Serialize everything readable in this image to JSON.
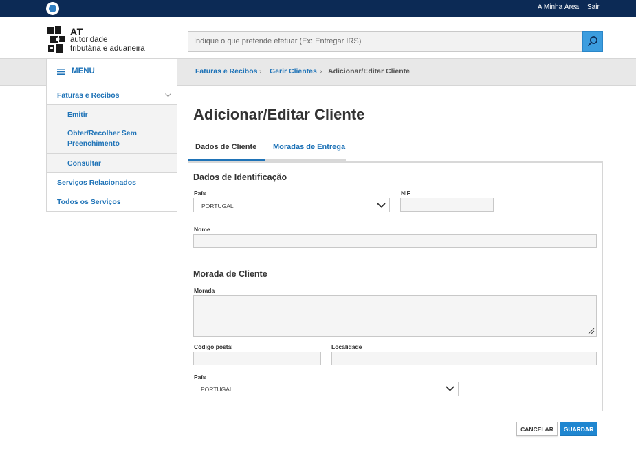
{
  "topbar": {
    "my_area": "A Minha Área",
    "logout": "Sair"
  },
  "brand": {
    "acronym": "AT",
    "line1": "autoridade",
    "line2": "tributária e aduaneira"
  },
  "search": {
    "placeholder": "Indique o que pretende efetuar (Ex: Entregar IRS)"
  },
  "menu": {
    "label": "MENU"
  },
  "breadcrumb": [
    {
      "label": "Faturas e Recibos"
    },
    {
      "label": "Gerir Clientes"
    },
    {
      "label": "Adicionar/Editar Cliente"
    }
  ],
  "sidebar": {
    "items": [
      {
        "label": "Faturas e Recibos"
      },
      {
        "label": "Emitir"
      },
      {
        "label": "Obter/Recolher Sem",
        "label2": "Preenchimento"
      },
      {
        "label": "Consultar"
      },
      {
        "label": "Serviços Relacionados"
      },
      {
        "label": "Todos os Serviços"
      }
    ]
  },
  "page": {
    "title": "Adicionar/Editar Cliente"
  },
  "tabs": [
    {
      "label": "Dados de Cliente",
      "active": true
    },
    {
      "label": "Moradas de Entrega",
      "active": false
    }
  ],
  "identification": {
    "title": "Dados de Identificação",
    "country_label": "País",
    "country_value": "PORTUGAL",
    "nif_label": "NIF",
    "nif_value": "",
    "name_label": "Nome",
    "name_value": ""
  },
  "address": {
    "title": "Morada de Cliente",
    "address_label": "Morada",
    "address_value": "",
    "postal_label": "Código postal",
    "postal_value": "",
    "locality_label": "Localidade",
    "locality_value": "",
    "country_label": "País",
    "country_value": "PORTUGAL"
  },
  "actions": {
    "cancel": "CANCELAR",
    "save": "GUARDAR"
  },
  "colors": {
    "topbar": "#0c2a55",
    "link": "#1f73b7",
    "primary_button": "#1f86d0",
    "search_button": "#3c9ddf"
  }
}
